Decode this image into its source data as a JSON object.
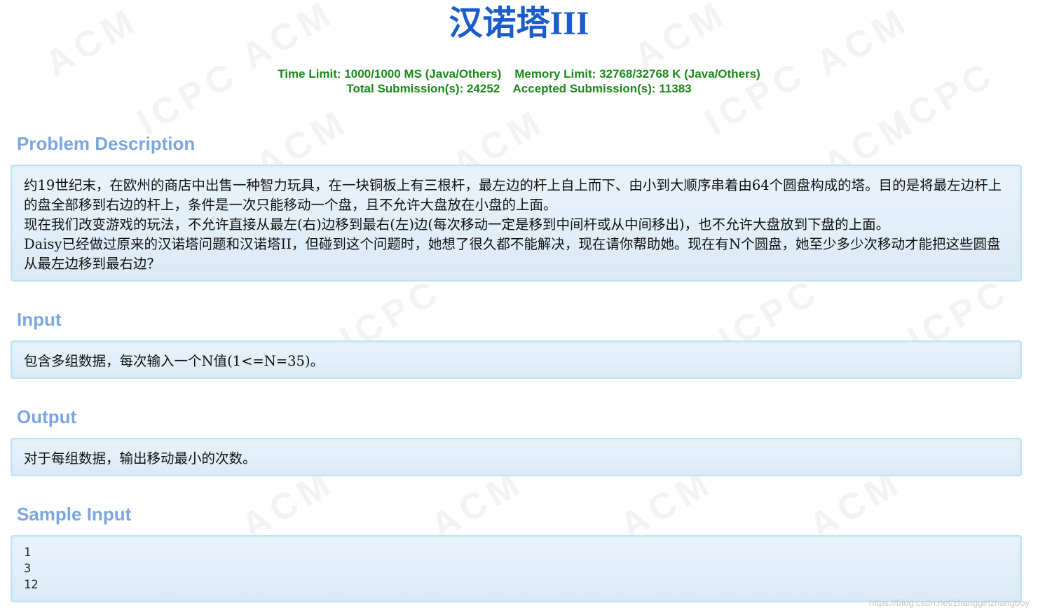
{
  "page": {
    "title": "汉诺塔III",
    "watermark_text_1": "ACM",
    "watermark_text_2": "ICPC",
    "credit": "https://blog.csdn.net/zhanggirlzhangboy"
  },
  "limits": {
    "time_limit": "Time Limit: 1000/1000 MS (Java/Others)",
    "memory_limit": "Memory Limit: 32768/32768 K (Java/Others)",
    "total_submissions": "Total Submission(s): 24252",
    "accepted_submissions": "Accepted Submission(s): 11383"
  },
  "sections": {
    "description": {
      "heading": "Problem Description",
      "paragraphs": [
        "约19世纪末，在欧州的商店中出售一种智力玩具，在一块铜板上有三根杆，最左边的杆上自上而下、由小到大顺序串着由64个圆盘构成的塔。目的是将最左边杆上的盘全部移到右边的杆上，条件是一次只能移动一个盘，且不允许大盘放在小盘的上面。",
        "现在我们改变游戏的玩法，不允许直接从最左(右)边移到最右(左)边(每次移动一定是移到中间杆或从中间移出)，也不允许大盘放到下盘的上面。",
        "Daisy已经做过原来的汉诺塔问题和汉诺塔II，但碰到这个问题时，她想了很久都不能解决，现在请你帮助她。现在有N个圆盘，她至少多少次移动才能把这些圆盘从最左边移到最右边？"
      ]
    },
    "input": {
      "heading": "Input",
      "text": "包含多组数据，每次输入一个N值(1<=N=35)。"
    },
    "output": {
      "heading": "Output",
      "text": "对于每组数据，输出移动最小的次数。"
    },
    "sample_input": {
      "heading": "Sample Input",
      "lines": [
        "1",
        "3",
        "12"
      ]
    }
  },
  "colors": {
    "title": "#1a5cc8",
    "limits": "#1a8a1a",
    "section_heading": "#7ca6e0",
    "panel_border": "#bfe3f5"
  }
}
